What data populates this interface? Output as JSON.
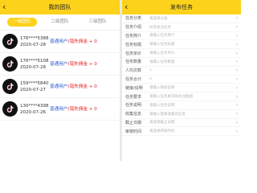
{
  "left": {
    "title": "我的团队",
    "back": "‹",
    "tabs": [
      "一级团队",
      "二级团队",
      "三级团队"
    ],
    "members": [
      {
        "phone": "176****5388",
        "date": "2020-07-28",
        "user_type": "普通用户",
        "status": "(错失佣金 + 0"
      },
      {
        "phone": "176****5108",
        "date": "2020-07-28",
        "user_type": "普通用户",
        "status": "(错失佣金 + 0"
      },
      {
        "phone": "159****5840",
        "date": "2020-07-27",
        "user_type": "普通用户",
        "status": "(错失佣金 + 0"
      },
      {
        "phone": "130****4398",
        "date": "2020-07-26",
        "user_type": "普通用户",
        "status": "(错失佣金 + 0"
      }
    ]
  },
  "right": {
    "title": "发布任务",
    "back": "‹",
    "fields": [
      {
        "label": "任务分类",
        "value": "请选择分类"
      },
      {
        "label": "任务介绍",
        "value": "抖音关注任务"
      },
      {
        "label": "任务简介",
        "value": "请输入任务简介"
      },
      {
        "label": "任务标题",
        "value": "请输入任务标题"
      },
      {
        "label": "任务单价",
        "value": "请输入任务单价"
      },
      {
        "label": "任务数量",
        "value": "请输入任务数量"
      },
      {
        "label": "人均次数",
        "value": "1"
      },
      {
        "label": "任务合计",
        "value": "0"
      },
      {
        "label": "链接/说明",
        "value": "请输入链接说明"
      },
      {
        "label": "任务要求",
        "value": "请输入任务要求如关注截图"
      },
      {
        "label": "任务说明",
        "value": "请输入任务说明"
      },
      {
        "label": "收集信息",
        "value": "请输入需要收集的信息"
      },
      {
        "label": "截止日期",
        "value": "请选择截止日期"
      },
      {
        "label": "审核时间",
        "value": "请选择审核时间"
      }
    ]
  }
}
